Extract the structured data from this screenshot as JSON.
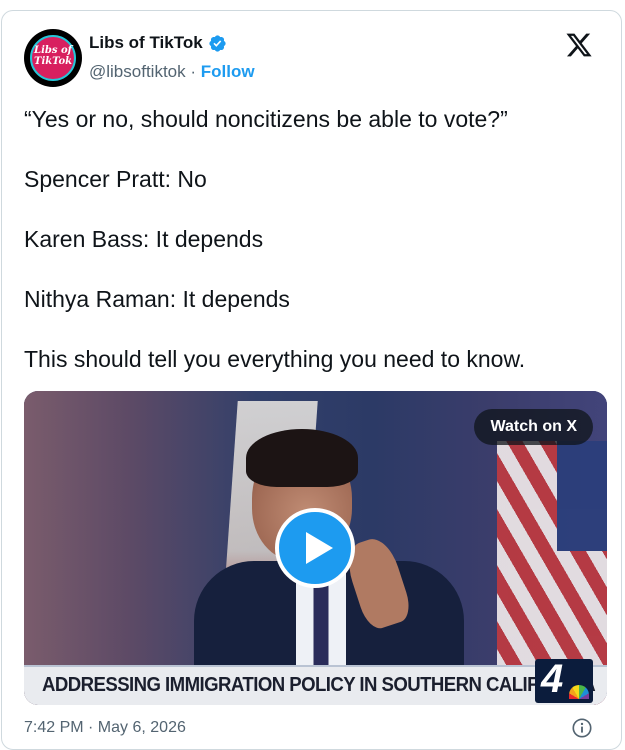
{
  "author": {
    "display_name": "Libs of TikTok",
    "handle": "@libsoftiktok",
    "separator": "·",
    "follow_label": "Follow",
    "avatar_text": "Libs of TikTok",
    "verified_icon": "verified-badge-icon",
    "verified_color": "#1d9bf0"
  },
  "tweet": {
    "paragraphs": [
      "“Yes or no, should noncitizens be able to vote?”",
      "Spencer Pratt: No",
      "Karen Bass: It depends",
      "Nithya Raman: It depends",
      "This should tell you everything you need to know."
    ]
  },
  "media": {
    "watch_label": "Watch on X",
    "chyron_text": "ADDRESSING IMMIGRATION POLICY IN SOUTHERN CALIFORNIA",
    "channel_logo": "4",
    "play_icon": "play-icon",
    "play_color": "#1d9bf0"
  },
  "footer": {
    "timestamp": "7:42 PM · May 6, 2026",
    "info_icon": "info-icon"
  },
  "platform": {
    "logo_icon": "x-logo-icon"
  },
  "colors": {
    "text": "#0f1419",
    "secondary": "#536471",
    "accent": "#1d9bf0",
    "border": "#cfd9de"
  }
}
